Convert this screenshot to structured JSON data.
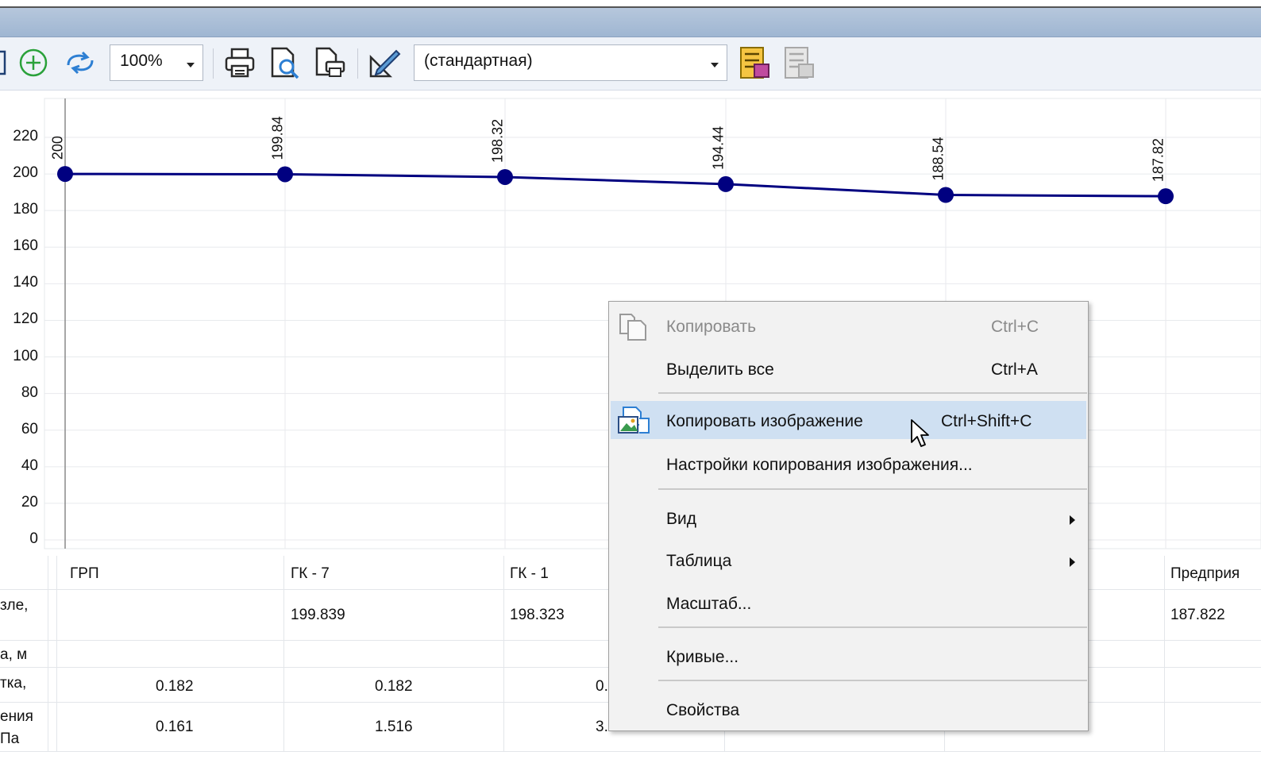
{
  "toolbar": {
    "zoom_value": "100%",
    "style_value": "(стандартная)"
  },
  "chart_data": {
    "type": "line",
    "categories": [
      "ГРП",
      "ГК - 7",
      "ГК - 1",
      "",
      "",
      "Предприя"
    ],
    "values": [
      200,
      199.84,
      198.32,
      194.44,
      188.54,
      187.82
    ],
    "data_labels": [
      "200",
      "199.84",
      "198.32",
      "194.44",
      "188.54",
      "187.82"
    ],
    "yticks": [
      "220",
      "200",
      "180",
      "160",
      "140",
      "120",
      "100",
      "80",
      "60",
      "40",
      "20",
      "0"
    ],
    "ylim": [
      0,
      220
    ],
    "grid": true,
    "color": "#000080"
  },
  "table": {
    "headers": [
      "ГРП",
      "ГК - 7",
      "ГК - 1",
      "Предприя"
    ],
    "row_labels": [
      "зле,",
      "а, м",
      "тка,",
      "ения",
      "Па"
    ],
    "row1": [
      "199.839",
      "198.323",
      "187.822"
    ],
    "row3": [
      "0.182",
      "0.182",
      "0."
    ],
    "row4": [
      "0.161",
      "1.516",
      "3."
    ]
  },
  "context_menu": {
    "items": [
      {
        "label": "Копировать",
        "shortcut": "Ctrl+C"
      },
      {
        "label": "Выделить все",
        "shortcut": "Ctrl+A"
      },
      {
        "label": "Копировать изображение",
        "shortcut": "Ctrl+Shift+C"
      },
      {
        "label": "Настройки копирования изображения..."
      },
      {
        "label": "Вид"
      },
      {
        "label": "Таблица"
      },
      {
        "label": "Масштаб..."
      },
      {
        "label": "Кривые..."
      },
      {
        "label": "Свойства"
      }
    ]
  }
}
